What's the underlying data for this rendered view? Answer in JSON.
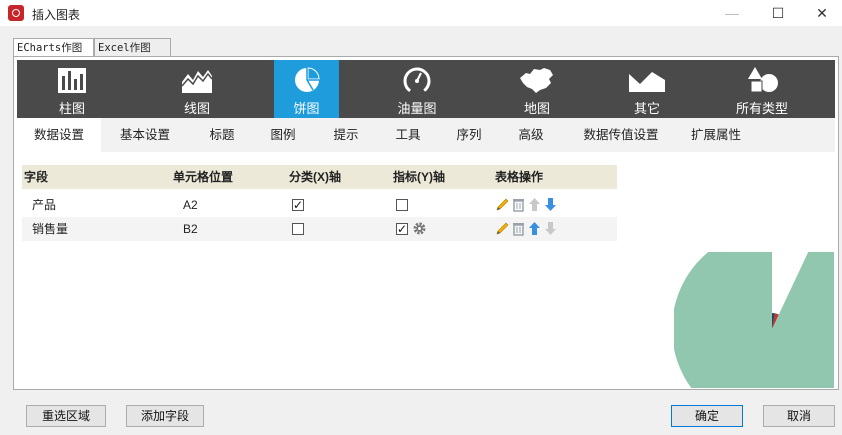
{
  "window": {
    "title": "插入图表",
    "min_glyph": "—",
    "max_glyph": "☐",
    "close_glyph": "✕"
  },
  "outer_tabs": [
    "ECharts作图",
    "Excel作图"
  ],
  "chart_types": [
    {
      "label": "柱图",
      "icon": "bar-chart-icon",
      "active": false
    },
    {
      "label": "线图",
      "icon": "line-chart-icon",
      "active": false
    },
    {
      "label": "饼图",
      "icon": "pie-chart-icon",
      "active": true
    },
    {
      "label": "油量图",
      "icon": "gauge-icon",
      "active": false
    },
    {
      "label": "地图",
      "icon": "map-icon",
      "active": false
    },
    {
      "label": "其它",
      "icon": "area-icon",
      "active": false
    },
    {
      "label": "所有类型",
      "icon": "shapes-icon",
      "active": false
    }
  ],
  "subtabs": [
    "数据设置",
    "基本设置",
    "标题",
    "图例",
    "提示",
    "工具",
    "序列",
    "高级",
    "数据传值设置",
    "扩展属性"
  ],
  "grid": {
    "headers": [
      "字段",
      "单元格位置",
      "分类(X)轴",
      "指标(Y)轴",
      "表格操作"
    ],
    "rows": [
      {
        "field": "产品",
        "cell": "A2",
        "x_axis": true,
        "y_axis": false,
        "y_gear": false
      },
      {
        "field": "销售量",
        "cell": "B2",
        "x_axis": false,
        "y_axis": true,
        "y_gear": true
      }
    ]
  },
  "preview": {
    "slices": [
      0.93,
      0.04,
      0.03
    ],
    "colors": [
      "#91c7ae",
      "#c23531",
      "#2f4554"
    ]
  },
  "buttons": {
    "reselect": "重选区域",
    "add_field": "添加字段",
    "ok": "确定",
    "cancel": "取消"
  },
  "colors": {
    "accent": "#1e9cdb",
    "toolbar_bg": "#4a4a4a",
    "grid_header": "#ece9d8"
  }
}
